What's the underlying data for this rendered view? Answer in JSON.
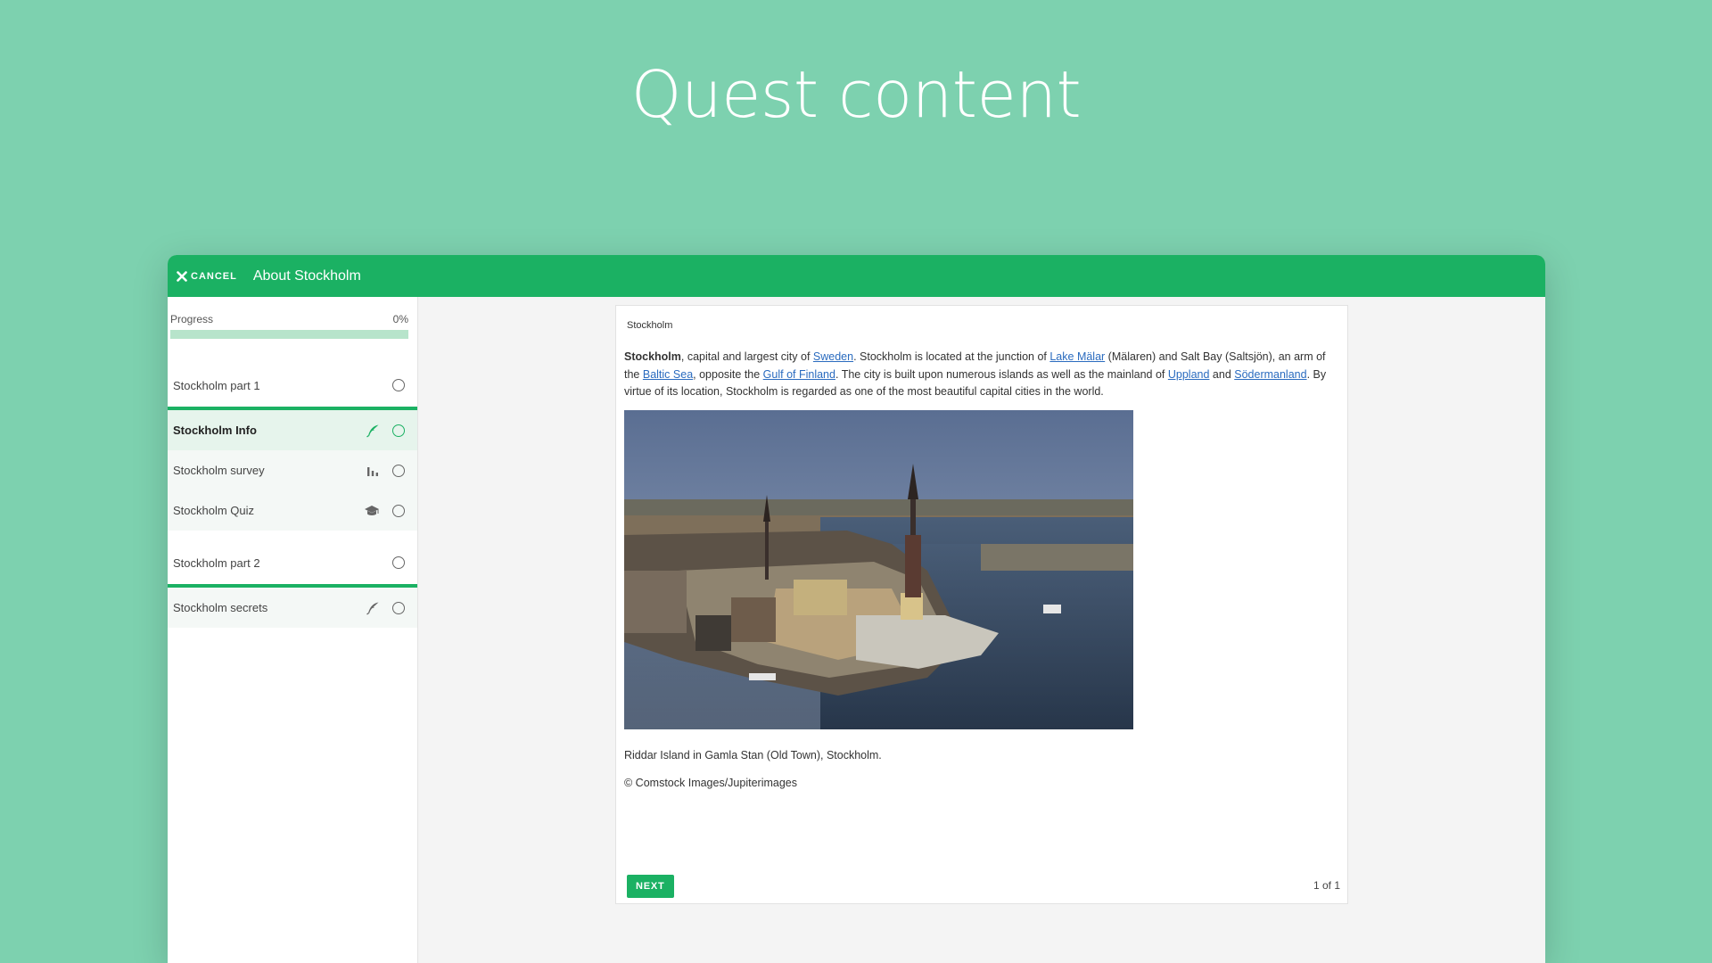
{
  "hero": {
    "title": "Quest content"
  },
  "topbar": {
    "cancel_label": "CANCEL",
    "title": "About Stockholm"
  },
  "sidebar": {
    "progress_label": "Progress",
    "progress_value": "0%",
    "progress_fraction": 0,
    "parts": [
      {
        "title": "Stockholm part 1",
        "items": [
          {
            "label": "Stockholm Info",
            "icon": "feather-icon",
            "active": true
          },
          {
            "label": "Stockholm survey",
            "icon": "bar-chart-icon",
            "active": false
          },
          {
            "label": "Stockholm Quiz",
            "icon": "graduation-cap-icon",
            "active": false
          }
        ]
      },
      {
        "title": "Stockholm part 2",
        "items": [
          {
            "label": "Stockholm secrets",
            "icon": "feather-icon",
            "active": false
          }
        ]
      }
    ]
  },
  "content": {
    "heading": "Stockholm",
    "paragraph": {
      "bold": "Stockholm",
      "t1": ", capital and largest city of ",
      "link1": "Sweden",
      "t2": ". Stockholm is located at the junction of ",
      "link2": "Lake Mälar",
      "t3": " (Mälaren) and Salt Bay (Saltsjön), an arm of the ",
      "link3": "Baltic Sea",
      "t4": ", opposite the ",
      "link4": "Gulf of Finland",
      "t5": ". The city is built upon numerous islands as well as the mainland of ",
      "link5": "Uppland",
      "t6": " and ",
      "link6": "Södermanland",
      "t7": ". By virtue of its location, Stockholm is regarded as one of the most beautiful capital cities in the world."
    },
    "caption": "Riddar Island in Gamla Stan (Old Town), Stockholm.",
    "credit": "© Comstock Images/Jupiterimages",
    "next_label": "NEXT",
    "pager": "1 of 1"
  },
  "colors": {
    "accent": "#1bb163",
    "background": "#7dd1af",
    "link": "#2a6bbf"
  }
}
